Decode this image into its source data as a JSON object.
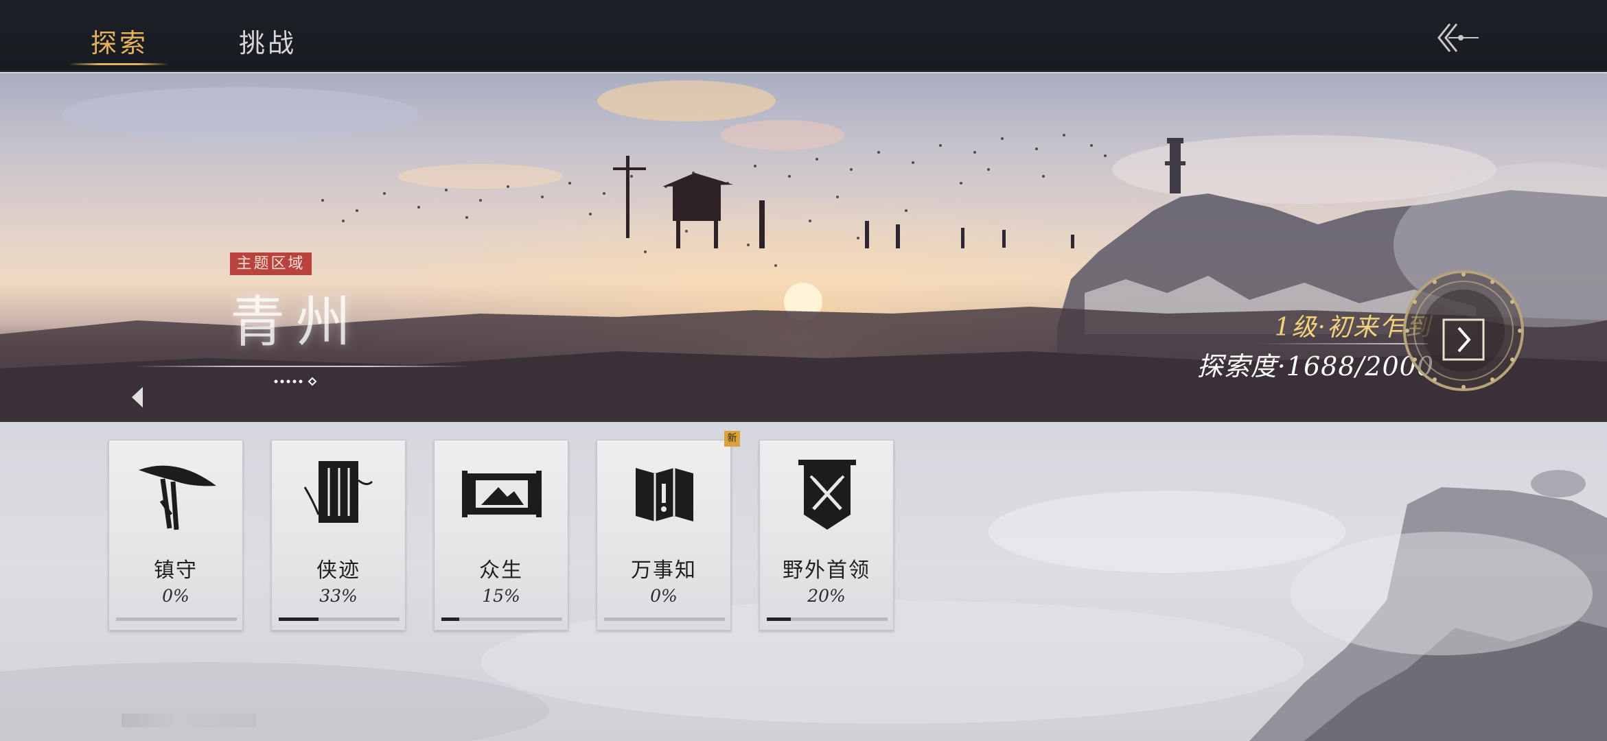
{
  "tabs": [
    {
      "label": "探索",
      "active": true
    },
    {
      "label": "挑战",
      "active": false
    }
  ],
  "back_icon": "back-arrow-icon",
  "banner": {
    "badge": "主题区域",
    "region_name": "青州",
    "level_text": "1级·初来乍到",
    "progress_text": "探索度·1688/2000",
    "exploration": {
      "current": 1688,
      "total": 2000
    }
  },
  "cards": [
    {
      "label": "镇守",
      "percent": "0%",
      "progress": 0,
      "icon": "straw-hat-sword-icon"
    },
    {
      "label": "侠迹",
      "percent": "33%",
      "progress": 0.33,
      "icon": "book-scroll-icon"
    },
    {
      "label": "众生",
      "percent": "15%",
      "progress": 0.15,
      "icon": "painting-scroll-icon"
    },
    {
      "label": "万事知",
      "percent": "0%",
      "progress": 0,
      "icon": "folded-map-icon",
      "badge": "新"
    },
    {
      "label": "野外首领",
      "percent": "20%",
      "progress": 0.2,
      "icon": "crossed-swords-banner-icon"
    }
  ],
  "colors": {
    "accent": "#e6b35a",
    "topbar": "#1b1e24",
    "badge_red": "#b9433c",
    "level_gold": "#f2d27c",
    "progress_fill": "#222226"
  }
}
